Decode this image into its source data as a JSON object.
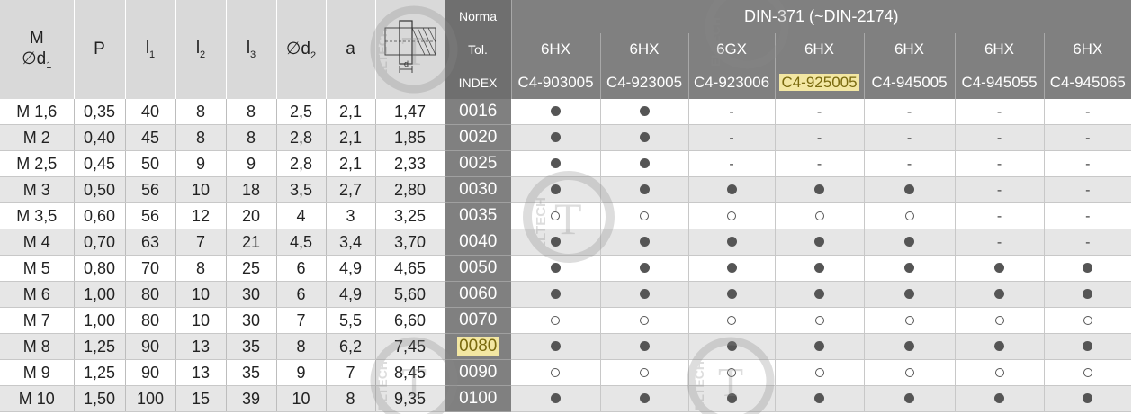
{
  "left_header": {
    "m_label": "M",
    "d1_label": "∅d",
    "d1_sub": "1",
    "p": "P",
    "l1": "l",
    "l1_sub": "1",
    "l2": "l",
    "l2_sub": "2",
    "l3": "l",
    "l3_sub": "3",
    "d2": "∅d",
    "d2_sub": "2",
    "a": "a",
    "diagram_label": "d"
  },
  "right_header": {
    "norma_label": "Norma",
    "norma_value": "DIN-371 (~DIN-2174)",
    "tol_label": "Tol.",
    "tolerances": [
      "6HX",
      "6HX",
      "6GX",
      "6HX",
      "6HX",
      "6HX",
      "6HX"
    ],
    "index_label": "INDEX",
    "codes": [
      "C4-903005",
      "C4-923005",
      "C4-923006",
      "C4-925005",
      "C4-945005",
      "C4-945055",
      "C4-945065"
    ]
  },
  "watermark": {
    "text": "ELTECH"
  },
  "rows": [
    {
      "m": "M 1,6",
      "p": "0,35",
      "l1": "40",
      "l2": "8",
      "l3": "8",
      "d2": "2,5",
      "a": "2,1",
      "diam": "1,47",
      "index": "0016",
      "marks": [
        "full",
        "full",
        "dash",
        "dash",
        "dash",
        "dash",
        "dash"
      ]
    },
    {
      "m": "M 2",
      "p": "0,40",
      "l1": "45",
      "l2": "8",
      "l3": "8",
      "d2": "2,8",
      "a": "2,1",
      "diam": "1,85",
      "index": "0020",
      "marks": [
        "full",
        "full",
        "dash",
        "dash",
        "dash",
        "dash",
        "dash"
      ]
    },
    {
      "m": "M 2,5",
      "p": "0,45",
      "l1": "50",
      "l2": "9",
      "l3": "9",
      "d2": "2,8",
      "a": "2,1",
      "diam": "2,33",
      "index": "0025",
      "marks": [
        "full",
        "full",
        "dash",
        "dash",
        "dash",
        "dash",
        "dash"
      ]
    },
    {
      "m": "M 3",
      "p": "0,50",
      "l1": "56",
      "l2": "10",
      "l3": "18",
      "d2": "3,5",
      "a": "2,7",
      "diam": "2,80",
      "index": "0030",
      "marks": [
        "full",
        "full",
        "full",
        "full",
        "full",
        "dash",
        "dash"
      ]
    },
    {
      "m": "M 3,5",
      "p": "0,60",
      "l1": "56",
      "l2": "12",
      "l3": "20",
      "d2": "4",
      "a": "3",
      "diam": "3,25",
      "index": "0035",
      "marks": [
        "empty",
        "empty",
        "empty",
        "empty",
        "empty",
        "dash",
        "dash"
      ]
    },
    {
      "m": "M 4",
      "p": "0,70",
      "l1": "63",
      "l2": "7",
      "l3": "21",
      "d2": "4,5",
      "a": "3,4",
      "diam": "3,70",
      "index": "0040",
      "marks": [
        "full",
        "full",
        "full",
        "full",
        "full",
        "dash",
        "dash"
      ]
    },
    {
      "m": "M 5",
      "p": "0,80",
      "l1": "70",
      "l2": "8",
      "l3": "25",
      "d2": "6",
      "a": "4,9",
      "diam": "4,65",
      "index": "0050",
      "marks": [
        "full",
        "full",
        "full",
        "full",
        "full",
        "full",
        "full"
      ]
    },
    {
      "m": "M 6",
      "p": "1,00",
      "l1": "80",
      "l2": "10",
      "l3": "30",
      "d2": "6",
      "a": "4,9",
      "diam": "5,60",
      "index": "0060",
      "marks": [
        "full",
        "full",
        "full",
        "full",
        "full",
        "full",
        "full"
      ]
    },
    {
      "m": "M 7",
      "p": "1,00",
      "l1": "80",
      "l2": "10",
      "l3": "30",
      "d2": "7",
      "a": "5,5",
      "diam": "6,60",
      "index": "0070",
      "marks": [
        "empty",
        "empty",
        "empty",
        "empty",
        "empty",
        "empty",
        "empty"
      ]
    },
    {
      "m": "M 8",
      "p": "1,25",
      "l1": "90",
      "l2": "13",
      "l3": "35",
      "d2": "8",
      "a": "6,2",
      "diam": "7,45",
      "index": "0080",
      "marks": [
        "full",
        "full",
        "full",
        "full",
        "full",
        "full",
        "full"
      ]
    },
    {
      "m": "M 9",
      "p": "1,25",
      "l1": "90",
      "l2": "13",
      "l3": "35",
      "d2": "9",
      "a": "7",
      "diam": "8,45",
      "index": "0090",
      "marks": [
        "empty",
        "empty",
        "empty",
        "empty",
        "empty",
        "empty",
        "empty"
      ]
    },
    {
      "m": "M 10",
      "p": "1,50",
      "l1": "100",
      "l2": "15",
      "l3": "39",
      "d2": "10",
      "a": "8",
      "diam": "9,35",
      "index": "0100",
      "marks": [
        "full",
        "full",
        "full",
        "full",
        "full",
        "full",
        "full"
      ]
    }
  ],
  "highlighted": {
    "code_col": 3,
    "index_row": 9
  }
}
